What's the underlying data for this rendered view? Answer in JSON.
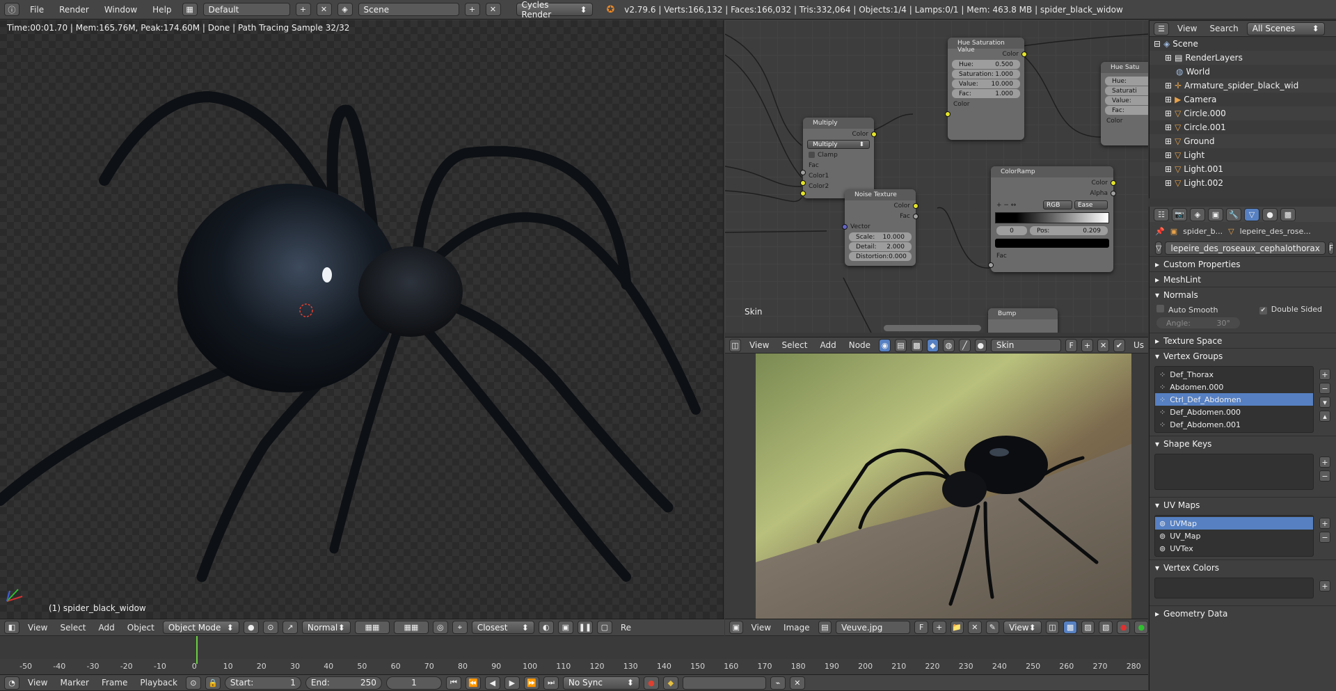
{
  "topbar": {
    "menus": [
      "File",
      "Render",
      "Window",
      "Help"
    ],
    "layout": "Default",
    "scene": "Scene",
    "engine": "Cycles Render",
    "stats": "v2.79.6 | Verts:166,132 | Faces:166,032 | Tris:332,064 | Objects:1/4 | Lamps:0/1 | Mem: 463.8 MB | spider_black_widow"
  },
  "viewport": {
    "status": "Time:00:01.70 | Mem:165.76M, Peak:174.60M | Done | Path Tracing Sample 32/32",
    "object_label": "(1) spider_black_widow",
    "header": {
      "menus": [
        "View",
        "Select",
        "Add",
        "Object"
      ],
      "mode": "Object Mode",
      "orientation": "Normal",
      "snap": "Closest",
      "truncated": "Re"
    }
  },
  "node_editor": {
    "label": "Skin",
    "nodes": {
      "hue_sat": {
        "title": "Hue Saturation Value",
        "output": "Color",
        "fields": [
          {
            "label": "Hue:",
            "value": "0.500"
          },
          {
            "label": "Saturation:",
            "value": "1.000"
          },
          {
            "label": "Value:",
            "value": "10.000"
          },
          {
            "label": "Fac:",
            "value": "1.000"
          }
        ],
        "input": "Color"
      },
      "hue_sat2": {
        "title": "Hue Satu",
        "fields": [
          "Hue:",
          "Saturati",
          "Value:",
          "Fac:"
        ],
        "input": "Color"
      },
      "multiply": {
        "title": "Multiply",
        "output": "Color",
        "mode": "Multiply",
        "clamp": "Clamp",
        "inputs": [
          "Fac",
          "Color1",
          "Color2"
        ]
      },
      "noise": {
        "title": "Noise Texture",
        "outputs": [
          "Color",
          "Fac"
        ],
        "input": "Vector",
        "fields": [
          {
            "label": "Scale:",
            "value": "10.000"
          },
          {
            "label": "Detail:",
            "value": "2.000"
          },
          {
            "label": "Distortion:",
            "value": "0.000"
          }
        ]
      },
      "colorramp": {
        "title": "ColorRamp",
        "outputs": [
          "Color",
          "Alpha"
        ],
        "mode": "RGB",
        "interp": "Ease",
        "index": "0",
        "pos_label": "Pos:",
        "pos_value": "0.209",
        "input": "Fac"
      },
      "bump": {
        "title": "Bump"
      }
    },
    "header": {
      "menus": [
        "View",
        "Select",
        "Add",
        "Node"
      ],
      "material": "Skin",
      "fake": "F",
      "use_nodes": "Us"
    }
  },
  "image_editor": {
    "header": {
      "menus": [
        "View",
        "Image"
      ],
      "image": "Veuve.jpg",
      "fake": "F",
      "view": "View"
    }
  },
  "outliner": {
    "header": {
      "menus": [
        "View",
        "Search"
      ],
      "filter": "All Scenes"
    },
    "rows": [
      "Scene",
      "RenderLayers",
      "World",
      "Armature_spider_black_wid",
      "Camera",
      "Circle.000",
      "Circle.001",
      "Ground",
      "Light",
      "Light.001",
      "Light.002"
    ]
  },
  "properties": {
    "breadcrumb": [
      "spider_b...",
      "lepeire_des_rose..."
    ],
    "mesh_name": "lepeire_des_roseaux_cephalothorax",
    "fake": "F",
    "panels": {
      "custom_props": "Custom Properties",
      "meshlint": "MeshLint",
      "normals": "Normals",
      "auto_smooth": "Auto Smooth",
      "double_sided": "Double Sided",
      "angle_label": "Angle:",
      "angle_value": "30°",
      "texture_space": "Texture Space",
      "vertex_groups": "Vertex Groups",
      "shape_keys": "Shape Keys",
      "uv_maps": "UV Maps",
      "vertex_colors": "Vertex Colors",
      "geometry_data": "Geometry Data"
    },
    "vertex_groups": [
      "Def_Thorax",
      "Abdomen.000",
      "Ctrl_Def_Abdomen",
      "Def_Abdomen.000",
      "Def_Abdomen.001"
    ],
    "vertex_group_selected": 2,
    "uv_maps": [
      "UVMap",
      "UV_Map",
      "UVTex"
    ],
    "uv_selected": 0
  },
  "timeline": {
    "ticks": [
      "-50",
      "-40",
      "-30",
      "-20",
      "-10",
      "0",
      "10",
      "20",
      "30",
      "40",
      "50",
      "60",
      "70",
      "80",
      "90",
      "100",
      "110",
      "120",
      "130",
      "140",
      "150",
      "160",
      "170",
      "180",
      "190",
      "200",
      "210",
      "220",
      "230",
      "240",
      "250",
      "260",
      "270",
      "280"
    ],
    "current_frame": 1,
    "menus": [
      "View",
      "Marker",
      "Frame",
      "Playback"
    ],
    "start_label": "Start:",
    "start": "1",
    "end_label": "End:",
    "end": "250",
    "frame": "1",
    "sync": "No Sync"
  }
}
